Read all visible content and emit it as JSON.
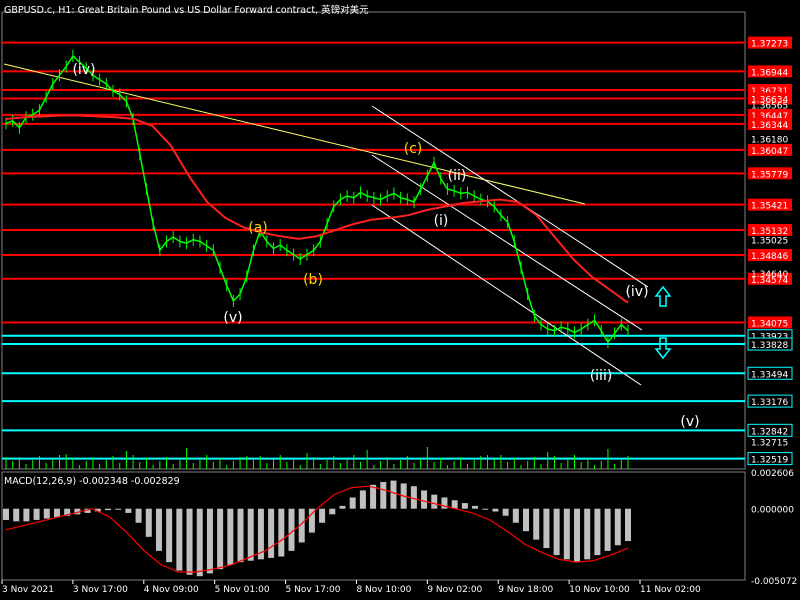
{
  "header": {
    "title": "GBPUSD.c, H1:  Great Britain Pound vs US Dollar Forward contract, 英镑对美元"
  },
  "macd_label": "MACD(12,26,9) -0.002348 -0.002829",
  "colors": {
    "background": "#000000",
    "candle": "#00ff00",
    "resistance": "#ff0000",
    "support": "#00ffff",
    "ma": "#ff2020",
    "trendline": "#ffff66",
    "channel": "#ffffff",
    "wave_yellow": "#ffd700",
    "wave_white": "#ffffff",
    "macd_hist": "#c0c0c0",
    "macd_signal": "#ff0000",
    "price_tag_bg": "#ff0000",
    "support_tag_bg": "#00ffff",
    "arrow": "#00ffff"
  },
  "chart_data": [
    {
      "type": "line",
      "panel": "price",
      "symbol": "GBPUSD.c",
      "timeframe": "H1",
      "ylim": [
        1.324,
        1.376
      ],
      "x_ticks": [
        "3 Nov 2021",
        "3 Nov 17:00",
        "4 Nov 09:00",
        "5 Nov 01:00",
        "5 Nov 17:00",
        "8 Nov 10:00",
        "9 Nov 02:00",
        "9 Nov 18:00",
        "10 Nov 10:00",
        "11 Nov 02:00"
      ],
      "y_ticks": [
        "1.36565",
        "1.36180",
        "1.35025",
        "1.34640"
      ],
      "close_series": [
        1.3635,
        1.3638,
        1.363,
        1.3642,
        1.3645,
        1.365,
        1.3665,
        1.368,
        1.369,
        1.37,
        1.3712,
        1.3705,
        1.3698,
        1.369,
        1.3685,
        1.368,
        1.3672,
        1.3668,
        1.366,
        1.364,
        1.36,
        1.356,
        1.352,
        1.349,
        1.35,
        1.3505,
        1.35,
        1.3498,
        1.3502,
        1.35,
        1.3495,
        1.349,
        1.347,
        1.345,
        1.3432,
        1.344,
        1.346,
        1.349,
        1.3512,
        1.35,
        1.3492,
        1.3496,
        1.349,
        1.3485,
        1.348,
        1.3485,
        1.349,
        1.35,
        1.352,
        1.354,
        1.3548,
        1.3552,
        1.355,
        1.3556,
        1.3552,
        1.355,
        1.3548,
        1.3552,
        1.3555,
        1.355,
        1.3548,
        1.3545,
        1.356,
        1.3575,
        1.359,
        1.3572,
        1.356,
        1.3558,
        1.3555,
        1.3556,
        1.3552,
        1.3548,
        1.3546,
        1.354,
        1.353,
        1.3522,
        1.35,
        1.347,
        1.344,
        1.3415,
        1.3405,
        1.34,
        1.3398,
        1.3402,
        1.34,
        1.3396,
        1.34,
        1.3405,
        1.341,
        1.3398,
        1.3385,
        1.3395,
        1.3405,
        1.3398
      ],
      "ma_series": [
        1.364,
        1.3642,
        1.3643,
        1.3644,
        1.3644,
        1.3643,
        1.3642,
        1.364,
        1.3632,
        1.361,
        1.3575,
        1.3545,
        1.3527,
        1.3516,
        1.351,
        1.3506,
        1.3503,
        1.3506,
        1.3513,
        1.352,
        1.3525,
        1.3527,
        1.353,
        1.3536,
        1.354,
        1.3544,
        1.3546,
        1.3548,
        1.3545,
        1.353,
        1.3505,
        1.348,
        1.346,
        1.3445,
        1.343
      ],
      "resistance_levels": [
        1.37273,
        1.36944,
        1.36731,
        1.36634,
        1.36447,
        1.36344,
        1.36047,
        1.35779,
        1.35421,
        1.35132,
        1.34846,
        1.34574,
        1.34075
      ],
      "support_levels": [
        1.33923,
        1.33828,
        1.33494,
        1.33176,
        1.32842,
        1.32519
      ],
      "intermediate_levels": [
        1.32715
      ],
      "wave_labels": [
        "(iv)",
        "(v)",
        "(a)",
        "(b)",
        "(c)",
        "(i)",
        "(ii)",
        "(iii)",
        "(iv)",
        "(v)"
      ]
    },
    {
      "type": "bar",
      "panel": "macd",
      "title": "MACD(12,26,9)",
      "ylim": [
        -0.00507,
        0.00261
      ],
      "y_ticks": [
        "0.002606",
        "0.000000",
        "-0.005072"
      ],
      "histogram": [
        -0.0008,
        -0.0009,
        -0.0009,
        -0.0008,
        -0.0007,
        -0.0006,
        -0.0005,
        -0.0004,
        -0.0003,
        -0.0002,
        -0.0001,
        0.0,
        -0.0003,
        -0.001,
        -0.002,
        -0.003,
        -0.0038,
        -0.0044,
        -0.0047,
        -0.0048,
        -0.0046,
        -0.0043,
        -0.004,
        -0.0038,
        -0.0037,
        -0.0036,
        -0.0035,
        -0.0034,
        -0.003,
        -0.0024,
        -0.0017,
        -0.001,
        -0.0004,
        0.0002,
        0.0008,
        0.0013,
        0.0017,
        0.0019,
        0.002,
        0.0018,
        0.0016,
        0.0013,
        0.001,
        0.0008,
        0.0006,
        0.0004,
        0.0002,
        0.0,
        -0.0002,
        -0.0005,
        -0.001,
        -0.0016,
        -0.0022,
        -0.0028,
        -0.0033,
        -0.0036,
        -0.0038,
        -0.0036,
        -0.0033,
        -0.003,
        -0.0026,
        -0.0023
      ],
      "signal": [
        -0.0015,
        -0.0012,
        -0.0009,
        -0.0006,
        -0.0003,
        0.0,
        -0.0006,
        -0.0017,
        -0.003,
        -0.004,
        -0.0045,
        -0.0045,
        -0.0043,
        -0.004,
        -0.0035,
        -0.003,
        -0.0022,
        -0.0012,
        0.0,
        0.001,
        0.0015,
        0.0016,
        0.0013,
        0.0009,
        0.0006,
        0.0003,
        0.0,
        -0.0003,
        -0.0008,
        -0.0016,
        -0.0025,
        -0.0031,
        -0.0036,
        -0.0038,
        -0.0037,
        -0.0033,
        -0.0028
      ]
    }
  ],
  "x_axis": {
    "ticks": [
      "3 Nov 2021",
      "3 Nov 17:00",
      "4 Nov 09:00",
      "5 Nov 01:00",
      "5 Nov 17:00",
      "8 Nov 10:00",
      "9 Nov 02:00",
      "9 Nov 18:00",
      "10 Nov 10:00",
      "11 Nov 02:00"
    ]
  }
}
